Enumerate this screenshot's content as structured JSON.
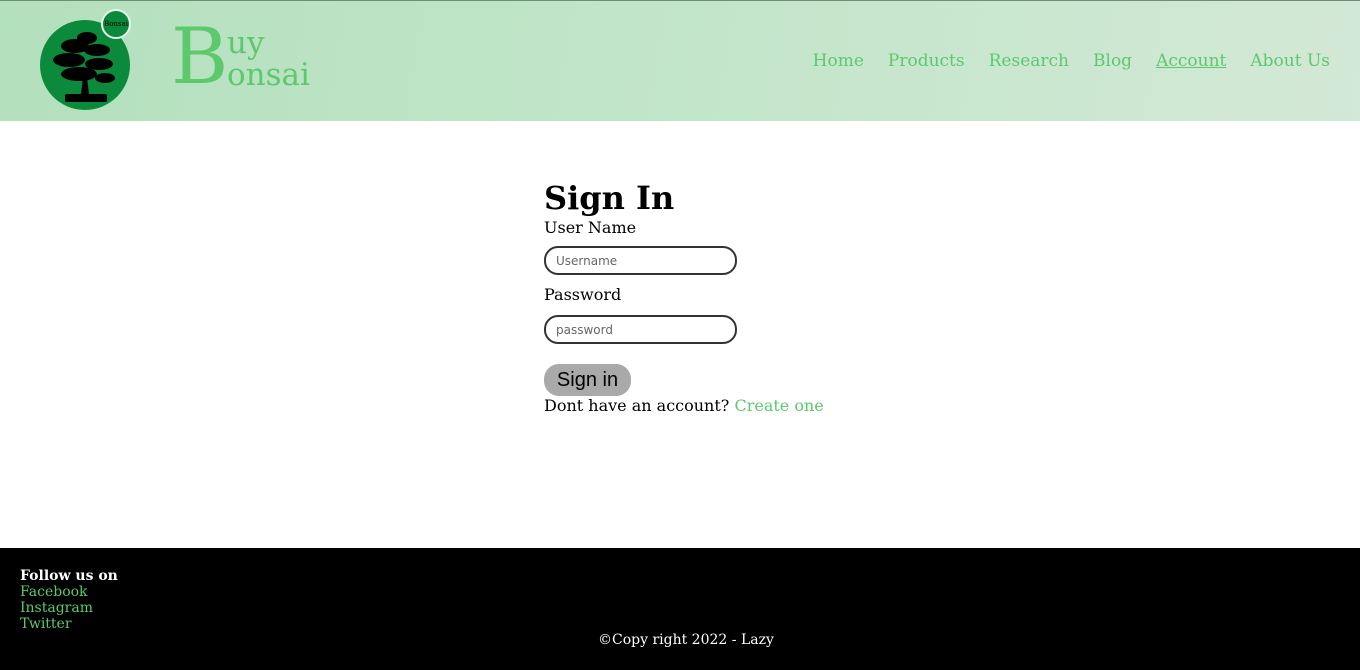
{
  "header": {
    "logo_badge_text": "Bonsai",
    "brand": {
      "initial": "B",
      "line1": "uy",
      "line2": "onsai"
    },
    "nav": [
      {
        "label": "Home"
      },
      {
        "label": "Products"
      },
      {
        "label": "Research"
      },
      {
        "label": "Blog"
      },
      {
        "label": "Account",
        "active": true
      },
      {
        "label": "About Us"
      }
    ]
  },
  "signin": {
    "title": "Sign In",
    "username_label": "User Name",
    "username_placeholder": "Username",
    "password_label": "Password",
    "password_placeholder": "password",
    "submit_label": "Sign in",
    "no_account_text": "Dont have an account?",
    "create_link": "Create one"
  },
  "footer": {
    "follow_title": "Follow us on",
    "links": [
      "Facebook",
      "Instagram",
      "Twitter"
    ],
    "copyright": "©Copy right 2022 - Lazy"
  },
  "colors": {
    "accent": "#5cc96d",
    "header_bg": "#b3e0bd",
    "logo_green": "#0a8a3a",
    "button_bg": "#a9a9a9",
    "footer_bg": "#000000"
  }
}
